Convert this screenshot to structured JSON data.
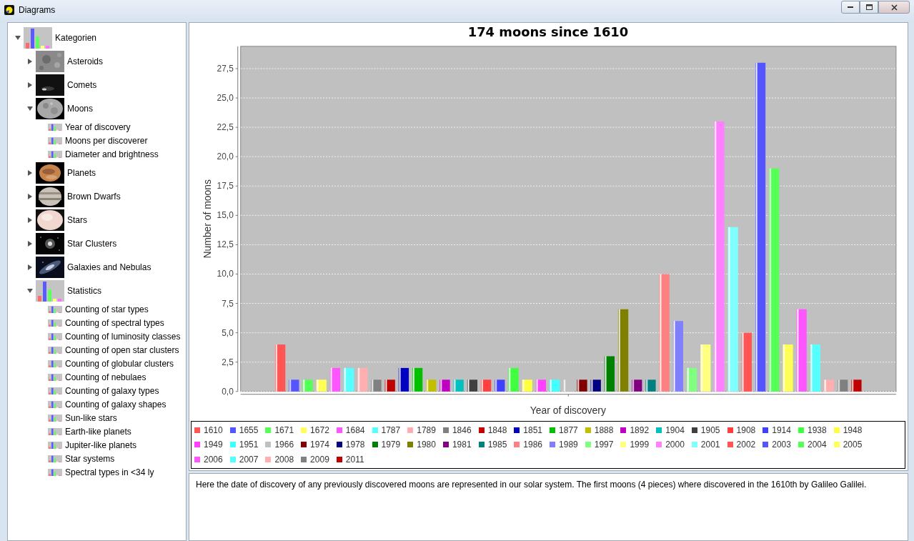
{
  "window": {
    "title": "Diagrams"
  },
  "tree": {
    "label": "Kategorien",
    "kind": "chart",
    "expanded": true,
    "children": [
      {
        "label": "Asteroids",
        "expanded": false
      },
      {
        "label": "Comets",
        "expanded": false
      },
      {
        "label": "Moons",
        "expanded": true,
        "children": [
          {
            "label": "Year of discovery",
            "kind": "report"
          },
          {
            "label": "Moons per discoverer",
            "kind": "report"
          },
          {
            "label": "Diameter and brightness",
            "kind": "report"
          }
        ]
      },
      {
        "label": "Planets",
        "expanded": false
      },
      {
        "label": "Brown Dwarfs",
        "expanded": false
      },
      {
        "label": "Stars",
        "expanded": false
      },
      {
        "label": "Star Clusters",
        "expanded": false
      },
      {
        "label": "Galaxies and Nebulas",
        "expanded": false
      },
      {
        "label": "Statistics",
        "kind": "chart",
        "expanded": true,
        "children": [
          {
            "label": "Counting of star types",
            "kind": "report"
          },
          {
            "label": "Counting of spectral types",
            "kind": "report"
          },
          {
            "label": "Counting of luminosity classes",
            "kind": "report"
          },
          {
            "label": "Counting of open star clusters",
            "kind": "report"
          },
          {
            "label": "Counting of globular clusters",
            "kind": "report"
          },
          {
            "label": "Counting of nebulaes",
            "kind": "report"
          },
          {
            "label": "Counting of galaxy types",
            "kind": "report"
          },
          {
            "label": "Counting of galaxy shapes",
            "kind": "report"
          },
          {
            "label": "Sun-like stars",
            "kind": "report"
          },
          {
            "label": "Earth-like planets",
            "kind": "report"
          },
          {
            "label": "Jupiter-like planets",
            "kind": "report"
          },
          {
            "label": "Star systems",
            "kind": "report"
          },
          {
            "label": "Spectral types in <34 ly",
            "kind": "report"
          }
        ]
      }
    ]
  },
  "chart": {
    "chart_data": {
      "type": "bar",
      "grid": true,
      "title": "174 moons since 1610",
      "xlabel": "Year of discovery",
      "ylabel": "Number of moons",
      "ylim": [
        0,
        29.4
      ],
      "yticks": [
        {
          "value": 0,
          "label": "0,0"
        },
        {
          "value": 2.5,
          "label": "2,5"
        },
        {
          "value": 5,
          "label": "5,0"
        },
        {
          "value": 7.5,
          "label": "7,5"
        },
        {
          "value": 10,
          "label": "10,0"
        },
        {
          "value": 12.5,
          "label": "12,5"
        },
        {
          "value": 15,
          "label": "15,0"
        },
        {
          "value": 17.5,
          "label": "17,5"
        },
        {
          "value": 20,
          "label": "20,0"
        },
        {
          "value": 22.5,
          "label": "22,5"
        },
        {
          "value": 25,
          "label": "25,0"
        },
        {
          "value": 27.5,
          "label": "27,5"
        }
      ],
      "series": [
        {
          "name": "1610",
          "color": "#ff5555",
          "values": [
            4
          ]
        },
        {
          "name": "1655",
          "color": "#5555ff",
          "values": [
            1
          ]
        },
        {
          "name": "1671",
          "color": "#55ff55",
          "values": [
            1
          ]
        },
        {
          "name": "1672",
          "color": "#ffff55",
          "values": [
            1
          ]
        },
        {
          "name": "1684",
          "color": "#ff55ff",
          "values": [
            2
          ]
        },
        {
          "name": "1787",
          "color": "#55ffff",
          "values": [
            2
          ]
        },
        {
          "name": "1789",
          "color": "#ffafaf",
          "values": [
            2
          ]
        },
        {
          "name": "1846",
          "color": "#808080",
          "values": [
            1
          ]
        },
        {
          "name": "1848",
          "color": "#c00000",
          "values": [
            1
          ]
        },
        {
          "name": "1851",
          "color": "#0000c0",
          "values": [
            2
          ]
        },
        {
          "name": "1877",
          "color": "#00c000",
          "values": [
            2
          ]
        },
        {
          "name": "1888",
          "color": "#c0c000",
          "values": [
            1
          ]
        },
        {
          "name": "1892",
          "color": "#c000c0",
          "values": [
            1
          ]
        },
        {
          "name": "1904",
          "color": "#00c0c0",
          "values": [
            1
          ]
        },
        {
          "name": "1905",
          "color": "#404040",
          "values": [
            1
          ]
        },
        {
          "name": "1908",
          "color": "#ff4040",
          "values": [
            1
          ]
        },
        {
          "name": "1914",
          "color": "#4040ff",
          "values": [
            1
          ]
        },
        {
          "name": "1938",
          "color": "#40ff40",
          "values": [
            2
          ]
        },
        {
          "name": "1948",
          "color": "#ffff40",
          "values": [
            1
          ]
        },
        {
          "name": "1949",
          "color": "#ff40ff",
          "values": [
            1
          ]
        },
        {
          "name": "1951",
          "color": "#40ffff",
          "values": [
            1
          ]
        },
        {
          "name": "1966",
          "color": "#c0c0c0",
          "values": [
            1
          ]
        },
        {
          "name": "1974",
          "color": "#800000",
          "values": [
            1
          ]
        },
        {
          "name": "1978",
          "color": "#000080",
          "values": [
            1
          ]
        },
        {
          "name": "1979",
          "color": "#008000",
          "values": [
            3
          ]
        },
        {
          "name": "1980",
          "color": "#808000",
          "values": [
            7
          ]
        },
        {
          "name": "1981",
          "color": "#800080",
          "values": [
            1
          ]
        },
        {
          "name": "1985",
          "color": "#008080",
          "values": [
            1
          ]
        },
        {
          "name": "1986",
          "color": "#ff8080",
          "values": [
            10
          ]
        },
        {
          "name": "1989",
          "color": "#8080ff",
          "values": [
            6
          ]
        },
        {
          "name": "1997",
          "color": "#80ff80",
          "values": [
            2
          ]
        },
        {
          "name": "1999",
          "color": "#ffff80",
          "values": [
            4
          ]
        },
        {
          "name": "2000",
          "color": "#ff80ff",
          "values": [
            23
          ]
        },
        {
          "name": "2001",
          "color": "#80ffff",
          "values": [
            14
          ]
        },
        {
          "name": "2002",
          "color": "#ff5555",
          "values": [
            5
          ]
        },
        {
          "name": "2003",
          "color": "#5555ff",
          "values": [
            28
          ]
        },
        {
          "name": "2004",
          "color": "#55ff55",
          "values": [
            19
          ]
        },
        {
          "name": "2005",
          "color": "#ffff55",
          "values": [
            4
          ]
        },
        {
          "name": "2006",
          "color": "#ff55ff",
          "values": [
            7
          ]
        },
        {
          "name": "2007",
          "color": "#55ffff",
          "values": [
            4
          ]
        },
        {
          "name": "2008",
          "color": "#ffafaf",
          "values": [
            1
          ]
        },
        {
          "name": "2009",
          "color": "#808080",
          "values": [
            1
          ]
        },
        {
          "name": "2011",
          "color": "#c00000",
          "values": [
            1
          ]
        }
      ]
    }
  },
  "description": "Here the date of discovery of any previously discovered moons are represented in our solar system. The first moons (4 pieces) where discovered in the 1610th by Galileo Galilei."
}
